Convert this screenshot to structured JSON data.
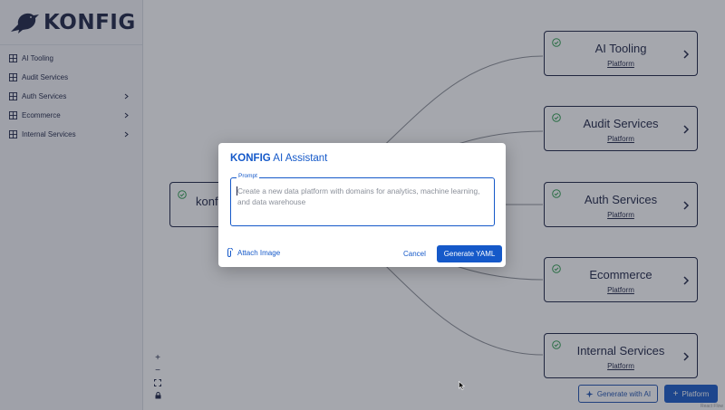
{
  "app": {
    "logo_text": "KONFIG"
  },
  "sidebar": {
    "items": [
      {
        "label": "AI Tooling",
        "expandable": false
      },
      {
        "label": "Audit Services",
        "expandable": false
      },
      {
        "label": "Auth Services",
        "expandable": true
      },
      {
        "label": "Ecommerce",
        "expandable": true
      },
      {
        "label": "Internal Services",
        "expandable": true
      }
    ]
  },
  "canvas": {
    "root_node": {
      "title": "konf"
    },
    "nodes": [
      {
        "title": "AI Tooling",
        "subtitle": "Platform"
      },
      {
        "title": "Audit Services",
        "subtitle": "Platform"
      },
      {
        "title": "Auth Services",
        "subtitle": "Platform"
      },
      {
        "title": "Ecommerce",
        "subtitle": "Platform"
      },
      {
        "title": "Internal Services",
        "subtitle": "Platform"
      }
    ],
    "zoom_controls": [
      "+",
      "−",
      "⛶",
      "🔒"
    ],
    "generate_ai_label": "Generate with AI",
    "add_platform_label": "Platform",
    "attribution": "React Flow"
  },
  "modal": {
    "title_brand": "KONFIG",
    "title_rest": " AI Assistant",
    "prompt_legend": "Prompt",
    "prompt_placeholder": "Create a new data platform with domains for analytics, machine learning, and data warehouse",
    "attach_label": "Attach Image",
    "cancel_label": "Cancel",
    "generate_label": "Generate YAML"
  },
  "colors": {
    "accent": "#1559c9",
    "navy": "#1b2142",
    "success": "#2e9e4f"
  }
}
